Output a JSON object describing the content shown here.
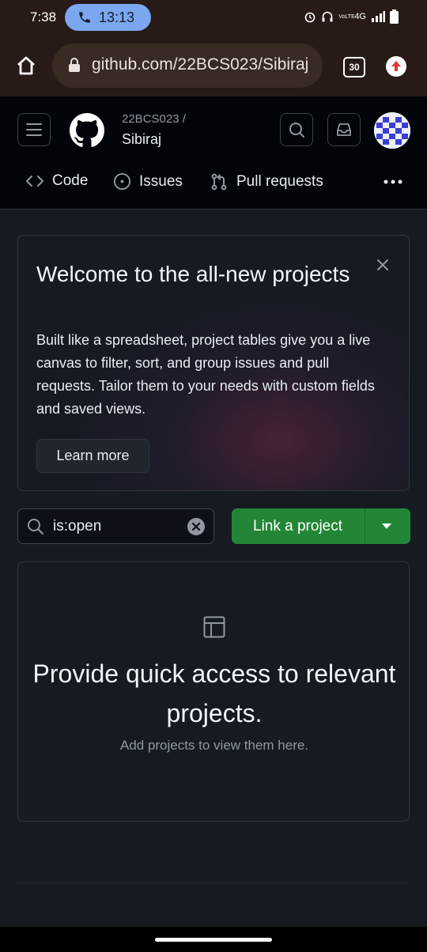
{
  "status_bar": {
    "time": "7:38",
    "call_duration": "13:13",
    "network": "4G",
    "lte_label": "VoLTE"
  },
  "browser": {
    "url": "github.com/22BCS023/Sibiraj",
    "tab_count": "30"
  },
  "repo": {
    "owner": "22BCS023 /",
    "name": "Sibiraj"
  },
  "nav": {
    "code": "Code",
    "issues": "Issues",
    "pull_requests": "Pull requests"
  },
  "banner": {
    "title": "Welcome to the all-new projects",
    "body": "Built like a spreadsheet, project tables give you a live canvas to filter, sort, and group issues and pull requests. Tailor them to your needs with custom fields and saved views.",
    "learn_more": "Learn more"
  },
  "filter": {
    "query": "is:open"
  },
  "actions": {
    "link_project": "Link a project"
  },
  "empty_state": {
    "title": "Provide quick access to relevant projects.",
    "subtitle": "Add projects to view them here."
  },
  "colors": {
    "primary_button": "#238636",
    "header_bg": "#010409",
    "page_bg": "#161b22"
  }
}
